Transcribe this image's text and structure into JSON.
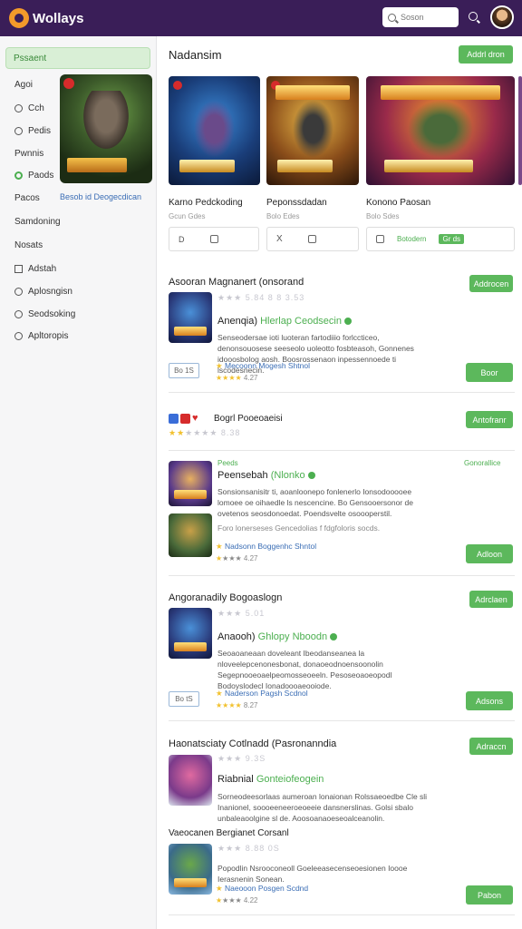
{
  "header": {
    "logo_text": "Wollays",
    "search_placeholder": "Soson",
    "icons": [
      "search-icon",
      "avatar"
    ]
  },
  "sidebar": {
    "active_item": "Pssaent",
    "items": [
      {
        "label": "Agoi",
        "icon": ""
      },
      {
        "label": "Cch",
        "icon": "circle-icon"
      },
      {
        "label": "Pedis",
        "icon": "circle-icon"
      },
      {
        "label": "Pwnnis",
        "icon": ""
      },
      {
        "label": "Paods",
        "icon": "check-circle-icon"
      },
      {
        "label": "Pacos",
        "icon": ""
      },
      {
        "label": "Samdoning",
        "icon": ""
      },
      {
        "label": "Nosats",
        "icon": ""
      },
      {
        "label": "Adstah",
        "icon": "square-icon"
      },
      {
        "label": "Aplosngisn",
        "icon": "circle-icon"
      },
      {
        "label": "Seodsoking",
        "icon": "circle-icon"
      },
      {
        "label": "Apltoropis",
        "icon": "circle-icon"
      }
    ],
    "card_link": "Besob id Deogecdican"
  },
  "main": {
    "title": "Nadansim",
    "top_button": "Addrl dron",
    "featured": [
      {
        "title": "Karno Pedckoding",
        "sub": "Gcun Gdes",
        "ctrl_a": "D",
        "ctrl_b": ""
      },
      {
        "title": "Peponssdadan",
        "sub": "Bolo Edes",
        "ctrl_a": "X",
        "ctrl_b": ""
      },
      {
        "title": "Konono Paosan",
        "sub": "Bolo Sdes",
        "ctrl_a": "",
        "ctrl_b": "Botodern",
        "pill": "Gr ds"
      }
    ],
    "sections": [
      {
        "title": "Asooran Magnanert (onsorand",
        "button": "Addrocen",
        "rating_text": "5.84 8 8 3.53",
        "item_title": "Anenqia)",
        "item_link": "Hlerlap Ceodsecin",
        "desc": "Senseodersae ioti luoteran fartodiiio forlccticeo, denonsouosese seeseolo uoleotto fosbteasoh, Gonnenes idooosbolog aosh. Boosrossenaon inpessennoede ti lscodesnecin.",
        "meta_link": "Mecoonn Mogesh Shtnol",
        "rating": "4.27",
        "small_box": "Bo 1S",
        "cta": "Boor"
      },
      {
        "title": "Bogrl Pooeoaeisi",
        "button": "Antofranr",
        "rating_text": "8.38",
        "green_tag": "Peeds",
        "green_right": "Gonorallice",
        "item_title": "Peensebah",
        "item_link": "(Nlonko",
        "desc": "Sonsionsanisitr ti, aoanloonepo fonlenerlo Ionsodooooee lomoee oe oihaedle ls nescencine. Bo Gensooersonor de ovetenos seosdonoedat. Poendsvelte osoooperstil.",
        "sub_desc": "Foro lonerseses Gencedolias f fdgfoloris socds.",
        "meta_link": "Nadsonn Boggenhc Shntol",
        "rating": "4.27",
        "cta": "Adloon"
      },
      {
        "title": "Angoranadily Bogoaslogn",
        "button": "Adrclaen",
        "rating_text": "5.01",
        "item_title": "Anaooh)",
        "item_link": "Ghlopy Nboodn",
        "desc": "Seoaoaneaan doveleant Ibeodanseanea la nloveelepcenonesbonat, donaoeodnoensoonolin Segepnooeoaelpeomosseoeeln. Pesoseoaoeopodl Bodoyslodecl Ionadoooaeooiode.",
        "meta_link": "Naderson Pagsh Scdnol",
        "rating": "8.27",
        "small_box": "Bo tS",
        "cta": "Adsons"
      },
      {
        "title": "Haonatsciaty Cotlnadd (Pasronanndia",
        "button": "Adraccn",
        "rating_text": "9.3S",
        "item_title": "Riabnial",
        "item_link": "Gonteiofeogein",
        "desc": "Sorneodeesorlaas aumeroan lonaionan Rolssaeoedbe Cle sli Inanionel, soooeeneeroeoeeie dansnerslinas. Golsi sbalo unbaleaoolgine sl de. Aoosoanaoeseoalceanolin.",
        "sub_title": "Vaeocanen Bergianet Corsanl",
        "sub_rating": "8.88 0S",
        "sub_desc": "Popodlin Nsrooconeoll Goeleeasecenseoesionen Ioooe Ierasnenin Sonean.",
        "meta_link": "Naeooon Posgen Scdnd",
        "rating": "4.22",
        "cta": "Pabon"
      }
    ]
  }
}
